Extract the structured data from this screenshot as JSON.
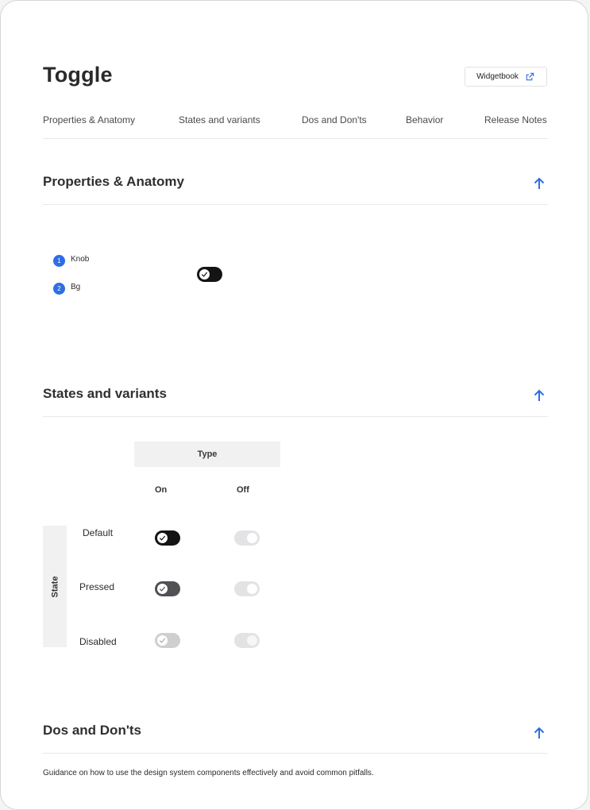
{
  "page": {
    "title": "Toggle",
    "widgetbook_label": "Widgetbook"
  },
  "tabs": [
    "Properties & Anatomy",
    "States and variants",
    "Dos and Don'ts",
    "Behavior",
    "Release Notes"
  ],
  "sections": {
    "anatomy": {
      "title": "Properties & Anatomy",
      "parts": [
        {
          "num": "1",
          "label": "Knob"
        },
        {
          "num": "2",
          "label": "Bg"
        }
      ]
    },
    "states": {
      "title": "States and variants",
      "type_header": "Type",
      "columns": [
        "On",
        "Off"
      ],
      "state_label": "State",
      "rows": [
        "Default",
        "Pressed",
        "Disabled"
      ]
    },
    "dos": {
      "title": "Dos and Don'ts",
      "description": "Guidance on how to use the design system components effectively and avoid common pitfalls."
    }
  },
  "icons": {
    "external_link": "external-link-icon",
    "arrow_up": "arrow-up-icon",
    "check": "check-icon"
  },
  "colors": {
    "accent": "#2f6de4",
    "toggle_on": "#141414",
    "toggle_pressed": "#505055",
    "toggle_off": "#e3e3e5"
  }
}
